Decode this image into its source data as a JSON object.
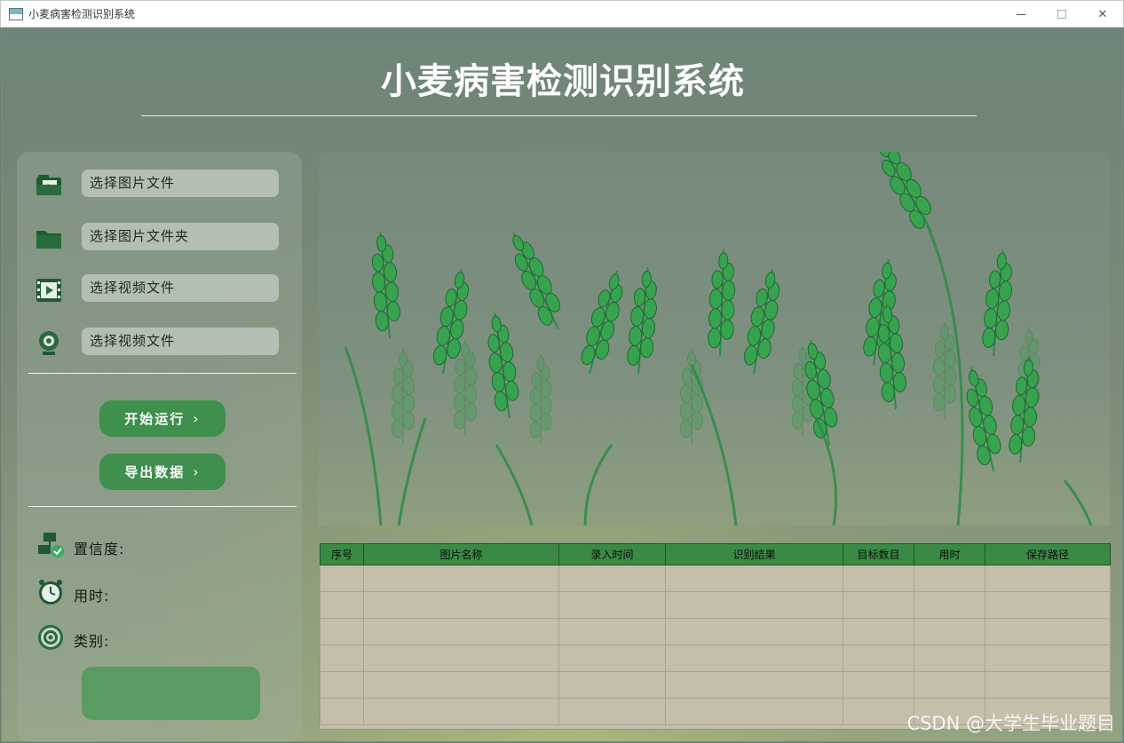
{
  "window": {
    "title": "小麦病害检测识别系统"
  },
  "header": {
    "title": "小麦病害检测识别系统"
  },
  "sidebar": {
    "file_buttons": [
      {
        "label": "选择图片文件",
        "icon": "image-file-icon"
      },
      {
        "label": "选择图片文件夹",
        "icon": "folder-icon"
      },
      {
        "label": "选择视频文件",
        "icon": "video-file-icon"
      },
      {
        "label": "选择视频文件",
        "icon": "webcam-icon"
      }
    ],
    "actions": {
      "start_label": "开始运行",
      "export_label": "导出数据"
    },
    "info": {
      "confidence_label": "置信度:",
      "time_label": "用时:",
      "class_label": "类别:"
    }
  },
  "table": {
    "columns": [
      "序号",
      "图片名称",
      "录入时间",
      "识别结果",
      "目标数目",
      "用时",
      "保存路径"
    ],
    "rows": [
      [
        "",
        "",
        "",
        "",
        "",
        "",
        ""
      ],
      [
        "",
        "",
        "",
        "",
        "",
        "",
        ""
      ],
      [
        "",
        "",
        "",
        "",
        "",
        "",
        ""
      ],
      [
        "",
        "",
        "",
        "",
        "",
        "",
        ""
      ],
      [
        "",
        "",
        "",
        "",
        "",
        "",
        ""
      ],
      [
        "",
        "",
        "",
        "",
        "",
        "",
        ""
      ]
    ]
  },
  "watermark": "CSDN @大学生毕业题目",
  "colors": {
    "accent": "#3f8f4d",
    "header_bg": "#3a8a46",
    "panel_button": "#b4bfb4",
    "table_cell": "#c5beab"
  }
}
